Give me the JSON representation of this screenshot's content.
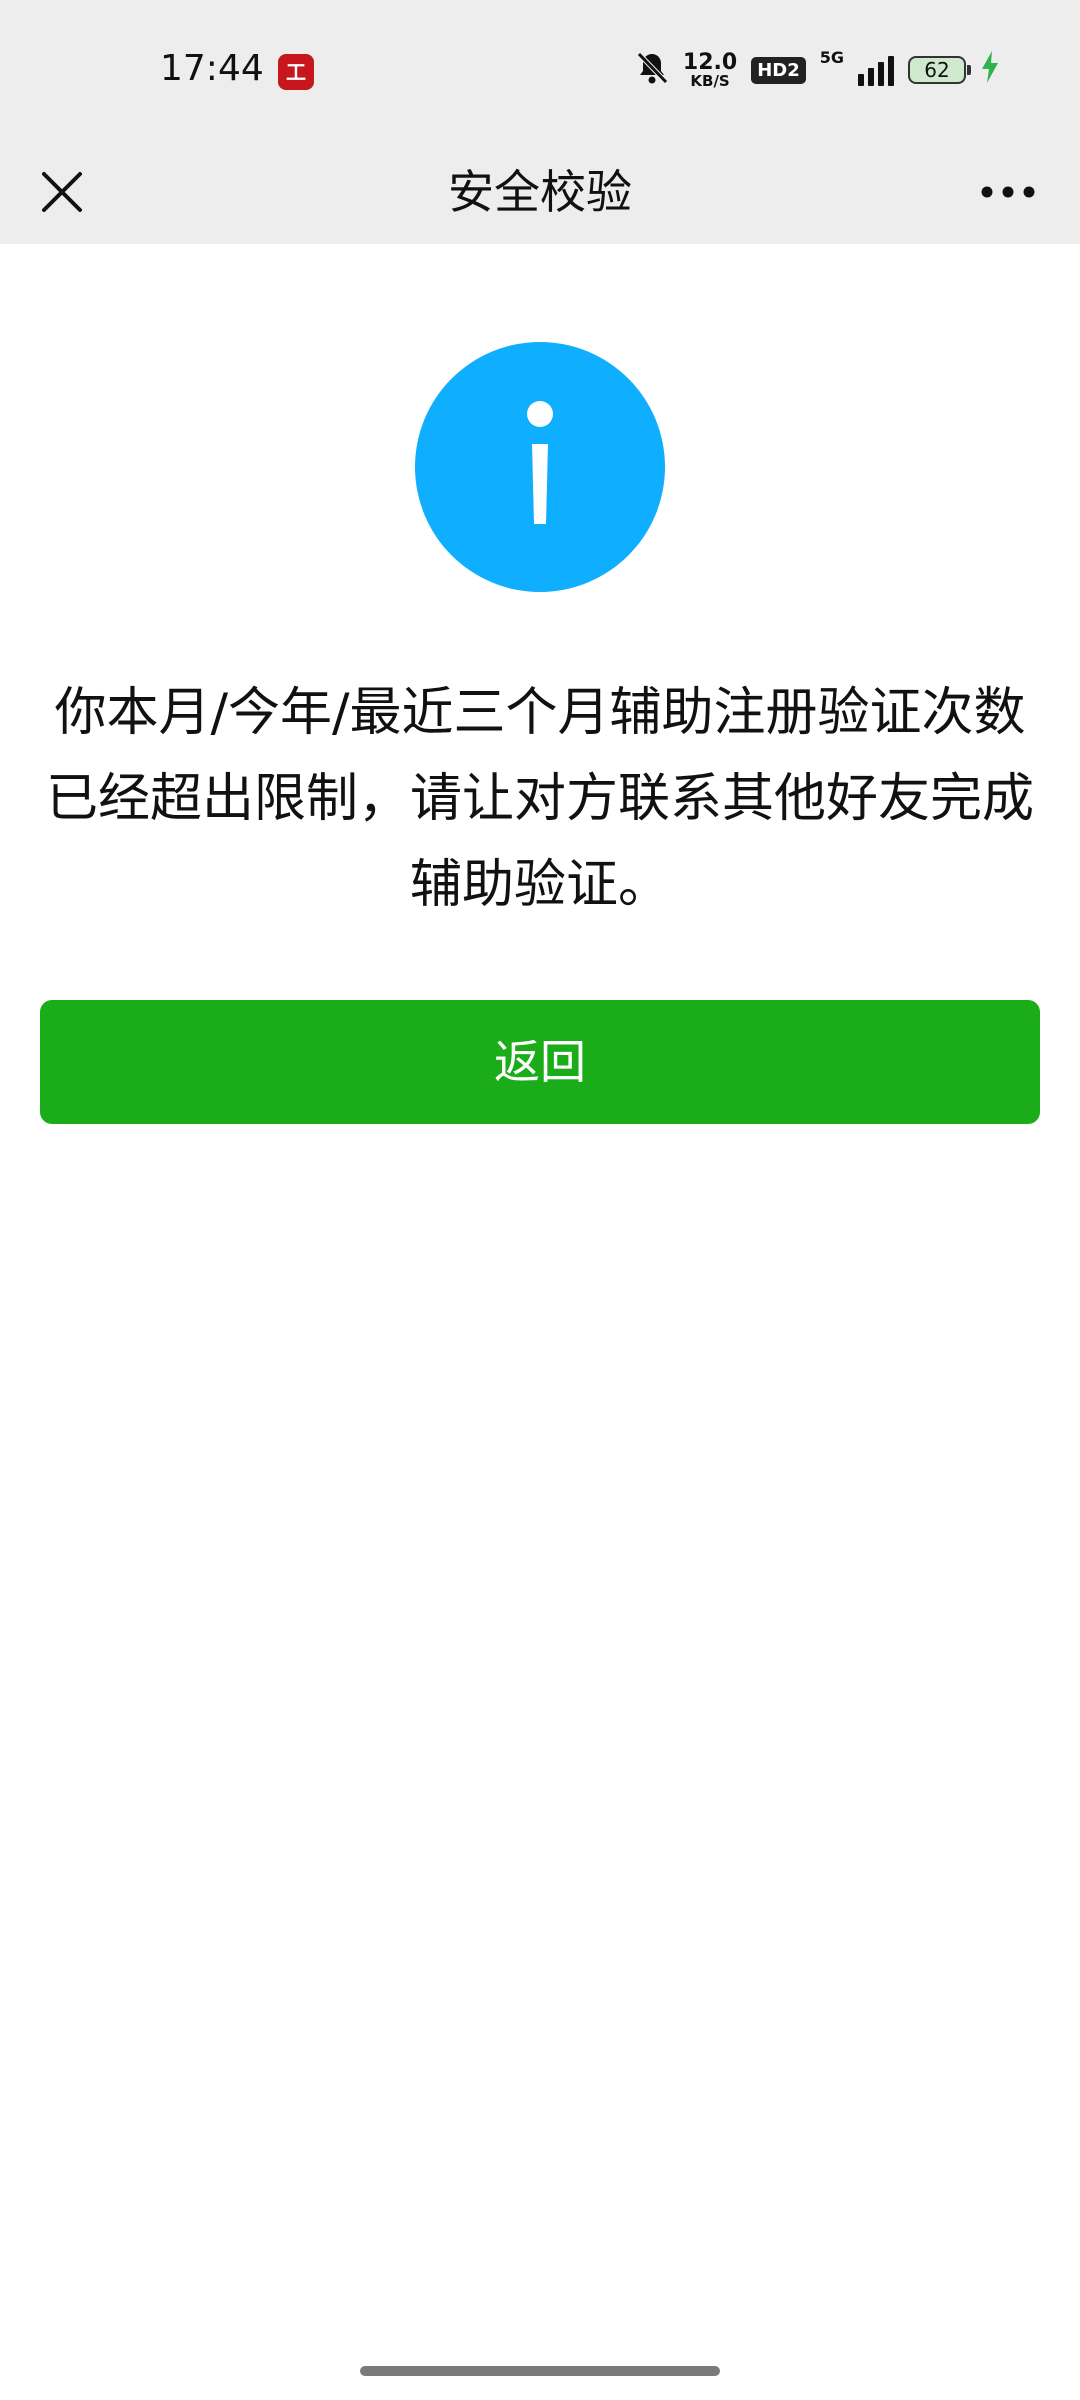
{
  "status_bar": {
    "time": "17:44",
    "app_badge": "工",
    "notifications_muted_icon": "bell-off-icon",
    "network_speed_value": "12.0",
    "network_speed_unit": "KB/S",
    "hd_label": "HD2",
    "network_type": "5G",
    "battery_level": "62",
    "charging_icon": "bolt-icon"
  },
  "nav": {
    "title": "安全校验",
    "close_icon": "close-icon",
    "more_icon": "more-icon"
  },
  "content": {
    "icon": "info-icon",
    "icon_color": "#10aefe",
    "message": "你本月/今年/最近三个月辅助注册验证次数已经超出限制，请让对方联系其他好友完成辅助验证。",
    "back_button_label": "返回",
    "back_button_color": "#1aad19"
  }
}
